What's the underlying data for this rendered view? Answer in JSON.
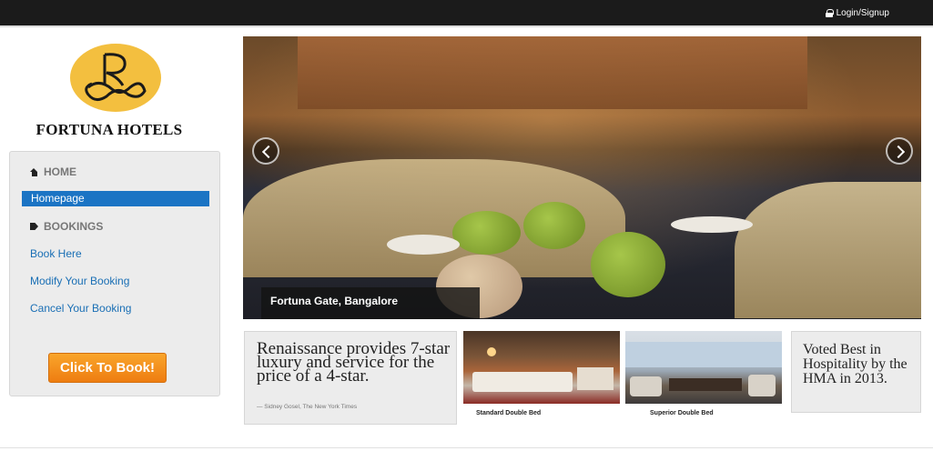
{
  "topbar": {
    "login_label": "Login/Signup"
  },
  "brand": {
    "name": "FORTUNA HOTELS",
    "logo_color": "#f3bf3f"
  },
  "sidebar": {
    "home_header": "HOME",
    "homepage_link": "Homepage",
    "bookings_header": "BOOKINGS",
    "book_here": "Book Here",
    "modify_booking": "Modify Your Booking",
    "cancel_booking": "Cancel Your Booking",
    "cta_label": "Click To Book!"
  },
  "hero": {
    "caption": "Fortuna Gate, Bangalore"
  },
  "quote": {
    "text": "Renaissance provides 7-star luxury and service for the price of a 4-star.",
    "author": "— Sidney Gosel, The New York Times"
  },
  "rooms": [
    {
      "label": "Standard Double Bed"
    },
    {
      "label": "Superior Double Bed"
    }
  ],
  "award": {
    "text": "Voted Best in Hospitality by the HMA in 2013."
  },
  "colors": {
    "accent": "#1b74c4",
    "cta": "#ee7d11",
    "topbar": "#1b1b1b"
  }
}
